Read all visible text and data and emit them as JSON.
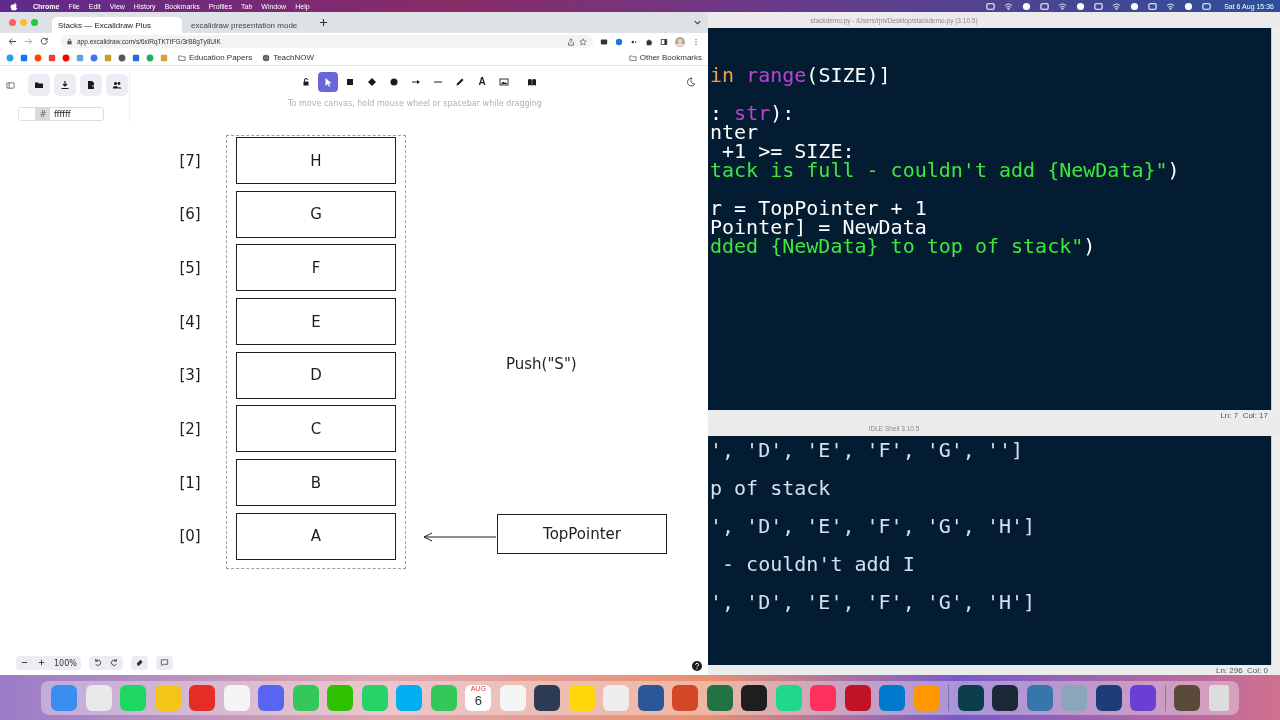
{
  "menubar": {
    "app": "Chrome",
    "menus": [
      "File",
      "Edit",
      "View",
      "History",
      "Bookmarks",
      "Profiles",
      "Tab",
      "Window",
      "Help"
    ],
    "clock": "Sat 6 Aug  15:36"
  },
  "browser": {
    "tabs": [
      {
        "title": "Stacks — Excalidraw Plus",
        "selected": true
      },
      {
        "title": "excalidraw presentation mode",
        "selected": false
      }
    ],
    "url": "app.excalidraw.com/s/6xlRqTKTtFG/3rB8gTy8UlK",
    "bookmarks": [
      {
        "label": "Education Papers",
        "kind": "folder"
      },
      {
        "label": "TeachNOW",
        "kind": "site"
      }
    ],
    "other_bookmarks": "Other Bookmarks"
  },
  "excalidraw": {
    "tools": [
      {
        "kind": "lock",
        "selected": false
      },
      {
        "kind": "select",
        "selected": true
      },
      {
        "kind": "rectangle",
        "selected": false
      },
      {
        "kind": "diamond",
        "selected": false
      },
      {
        "kind": "ellipse",
        "selected": false
      },
      {
        "kind": "arrow",
        "selected": false
      },
      {
        "kind": "line",
        "selected": false
      },
      {
        "kind": "pencil",
        "selected": false
      },
      {
        "kind": "text",
        "selected": false,
        "glyph": "A"
      },
      {
        "kind": "image",
        "selected": false
      },
      {
        "kind": "library",
        "selected": false
      }
    ],
    "hint": "To move canvas, hold mouse wheel or spacebar while dragging",
    "color_field": {
      "prefix": "#",
      "value": "ffffff"
    },
    "zoom": "100%",
    "stack": [
      {
        "index": "[7]",
        "value": "H"
      },
      {
        "index": "[6]",
        "value": "G"
      },
      {
        "index": "[5]",
        "value": "F"
      },
      {
        "index": "[4]",
        "value": "E"
      },
      {
        "index": "[3]",
        "value": "D"
      },
      {
        "index": "[2]",
        "value": "C"
      },
      {
        "index": "[1]",
        "value": "B"
      },
      {
        "index": "[0]",
        "value": "A"
      }
    ],
    "push_label": "Push(\"S\")",
    "pointer": "TopPointer"
  },
  "editor": {
    "title": "stackdemo.py - /Users/rjm/Desktop/stackdemo.py (3.10.5)",
    "blocks": [
      [
        [
          {
            "kind": "keyword",
            "text": "in "
          },
          {
            "kind": "builtin",
            "text": "range"
          },
          {
            "kind": "plain",
            "text": "(SIZE)]"
          }
        ]
      ],
      [
        [
          {
            "kind": "plain",
            "text": ": "
          },
          {
            "kind": "builtin",
            "text": "str"
          },
          {
            "kind": "plain",
            "text": "):"
          }
        ],
        [
          {
            "kind": "plain",
            "text": "nter"
          }
        ],
        [
          {
            "kind": "plain",
            "text": " +1 >= SIZE:"
          }
        ],
        [
          {
            "kind": "string",
            "text": "tack is full - couldn't add {NewData}\""
          },
          {
            "kind": "plain",
            "text": ")"
          }
        ]
      ],
      [
        [
          {
            "kind": "plain",
            "text": "r = TopPointer + 1"
          }
        ],
        [
          {
            "kind": "plain",
            "text": "Pointer] = NewData"
          }
        ],
        [
          {
            "kind": "string",
            "text": "dded {NewData} to top of stack\""
          },
          {
            "kind": "plain",
            "text": ")"
          }
        ]
      ]
    ],
    "status": "Ln: 7  Col: 17"
  },
  "shell": {
    "title": "IDLE Shell 3.10.5",
    "lines": [
      "', 'D', 'E', 'F', 'G', '']",
      "p of stack",
      "', 'D', 'E', 'F', 'G', 'H']",
      " - couldn't add I",
      "', 'D', 'E', 'F', 'G', 'H']"
    ],
    "status": "Ln: 296  Col: 0"
  },
  "dock": {
    "calendar_month": "AUG",
    "calendar_day": "6"
  }
}
